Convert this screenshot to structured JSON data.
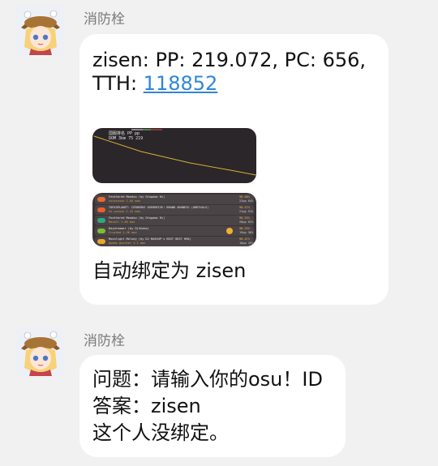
{
  "messages": [
    {
      "sender": "消防栓",
      "avatar_icon": "anime-girl-avatar-icon",
      "lines": {
        "line1": "zisen: PP: 219.072, PC: 656,",
        "tth_label": "TTH: ",
        "tth_value": "118852",
        "footer": "自动绑定为 zisen"
      },
      "chart_image": {
        "header_row1": "国服排名   PP         pp",
        "header_row2": "DOM  3km   75         219"
      },
      "scores_image": {
        "rows": [
          {
            "title": "Feathered Meadow (by Otogamo Hi)",
            "sub": "xxxxxxxxx  1.84 max",
            "acc": "98.08%",
            "pp": "22pp  64%",
            "badge": "#e76c2e"
          },
          {
            "title": "TORIOPLANET: CERBERUS OVERDRIVE: BRAND ARKNESS (ARRIVALS)",
            "sub": "Xx.xxxxxx  1.41 max",
            "acc": "98.47%",
            "pp": "21pp  91%",
            "badge": "#e8602a"
          },
          {
            "title": "Feathered Meadow (by Otogamo Hi)",
            "sub": "Recall   1.84 max",
            "acc": "98.53%",
            "pp": "20pp  62%",
            "badge": "#2ea883"
          },
          {
            "title": "Daydreamer (by DjShoba)",
            "sub": "Crushed   1.26 max",
            "acc": "98.53%",
            "pp": "19pp  56%",
            "badge": "#7bbf31"
          },
          {
            "title": "Moonlight Melody (by DJ MASHUP's BEST BEST RMX)",
            "sub": "Awake pointer  1.1 max",
            "acc": "98.47%",
            "pp": "18pp  45%",
            "badge": "#e8a82a"
          }
        ]
      }
    },
    {
      "sender": "消防栓",
      "avatar_icon": "anime-girl-avatar-icon",
      "lines": {
        "q1": "问题：请输入你的osu！ID",
        "q2": "答案：zisen",
        "q3": "这个人没绑定。"
      }
    }
  ],
  "colors": {
    "background": "#f1f1f1",
    "bubble": "#ffffff",
    "link": "#2f86d8",
    "sender": "#7a7a7a"
  }
}
